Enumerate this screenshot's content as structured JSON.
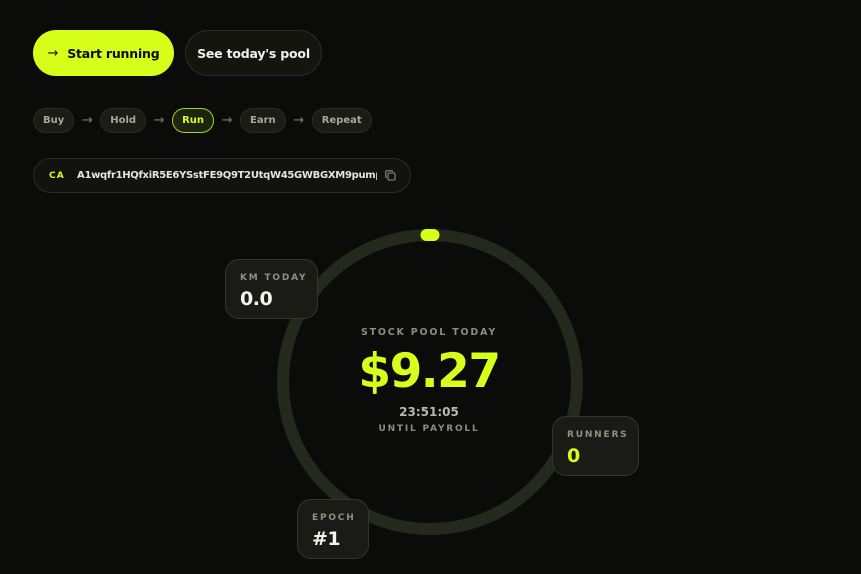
{
  "hero": {
    "start_label": "Start running",
    "start_icon": "arrow-right-icon",
    "pool_label": "See today's pool"
  },
  "steps": [
    {
      "label": "Buy",
      "active": false
    },
    {
      "label": "Hold",
      "active": false
    },
    {
      "label": "Run",
      "active": true
    },
    {
      "label": "Earn",
      "active": false
    },
    {
      "label": "Repeat",
      "active": false
    }
  ],
  "step_arrow": "→",
  "contract": {
    "label": "CA",
    "address": "A1wqfr1HQfxiR5E6YSstFE9Q9T2UtqW45GWBGXM9pump",
    "copy_icon": "copy-icon"
  },
  "pool": {
    "label": "STOCK POOL TODAY",
    "value": "$9.27",
    "timer": "23:51:05",
    "until_label": "UNTIL PAYROLL",
    "progress_fraction": 0.0
  },
  "stats": {
    "km": {
      "label": "KM TODAY",
      "value": "0.0"
    },
    "runners": {
      "label": "RUNNERS",
      "value": "0"
    },
    "epoch": {
      "label": "EPOCH",
      "value": "#1"
    }
  },
  "colors": {
    "accent": "#d8ff1a",
    "background": "#0b0c09",
    "ring_track": "#25281c"
  }
}
